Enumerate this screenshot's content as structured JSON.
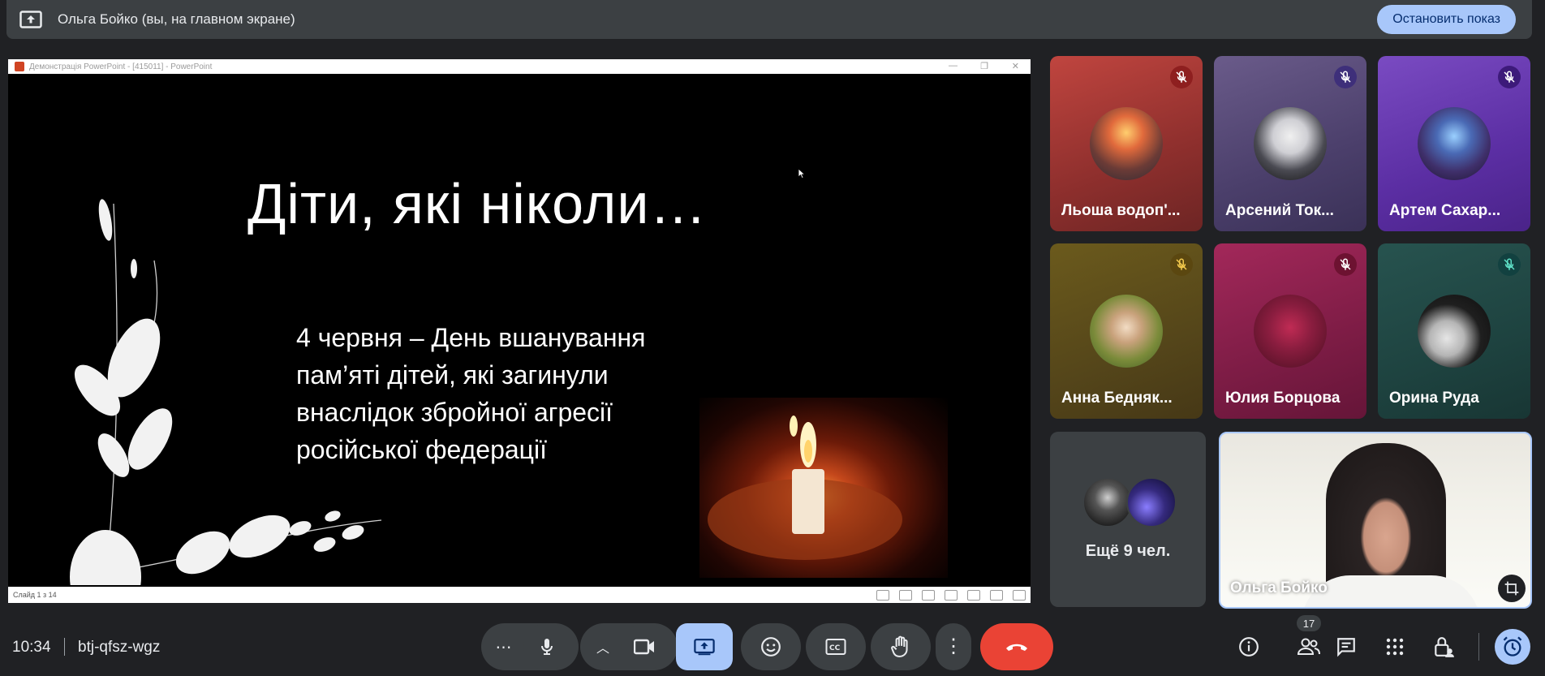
{
  "banner": {
    "title": "Ольга Бойко (вы, на главном экране)",
    "stop_label": "Остановить показ"
  },
  "ppt_window": {
    "window_title": "Демонстрація PowerPoint - [415011] - PowerPoint",
    "status_slide": "Слайд 1 з 14"
  },
  "slide": {
    "title": "Діти, які ніколи…",
    "body_lines": [
      "4 червня – День вшанування",
      "пам’яті дітей, які загинули",
      "внаслідок збройної агресії",
      "російської федерації"
    ]
  },
  "participants": [
    {
      "name": "Льоша водоп'...",
      "muted": true
    },
    {
      "name": "Арсений Ток...",
      "muted": true
    },
    {
      "name": "Артем Сахар...",
      "muted": true
    },
    {
      "name": "Анна Бедняк...",
      "muted": true
    },
    {
      "name": "Юлия Борцова",
      "muted": true
    },
    {
      "name": "Орина Руда",
      "muted": true
    }
  ],
  "more_tile": {
    "label": "Ещё 9 чел."
  },
  "self_tile": {
    "name": "Ольга Бойко"
  },
  "bottom_bar": {
    "time": "10:34",
    "meeting_code": "btj-qfsz-wgz",
    "participants_count": "17"
  },
  "colors": {
    "background": "#202124",
    "surface": "#3c4043",
    "accent_blue": "#a8c7fa",
    "end_call_red": "#ea4335",
    "present_active": "#a8c7fa"
  }
}
